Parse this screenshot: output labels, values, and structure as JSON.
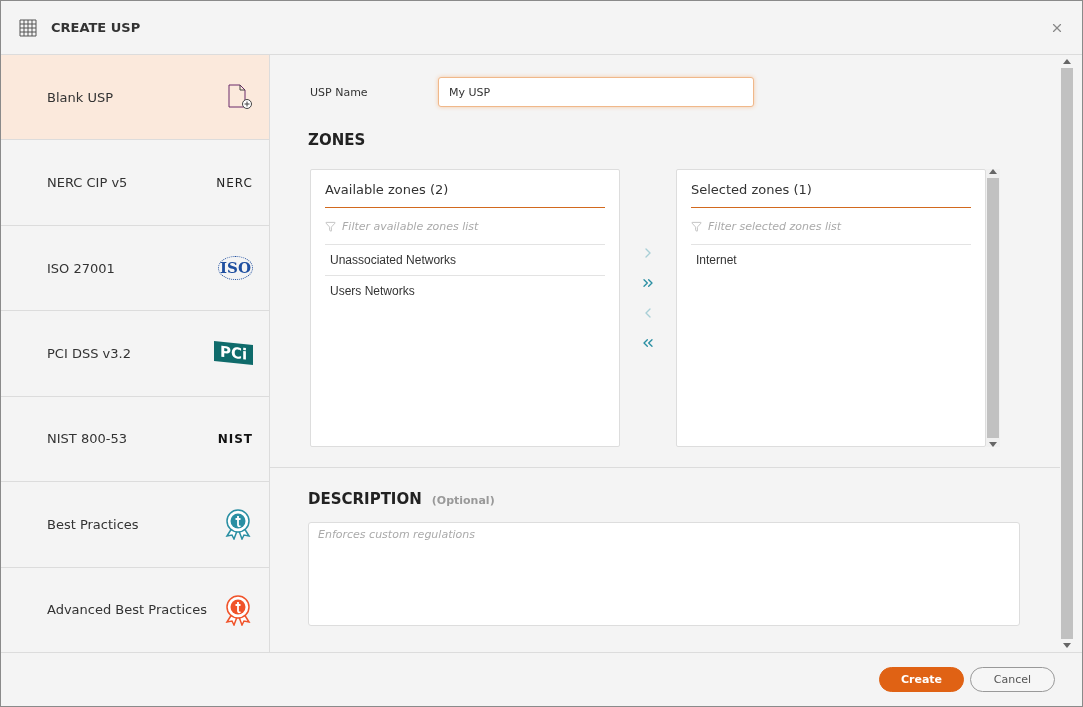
{
  "window": {
    "title": "CREATE USP"
  },
  "templates": [
    {
      "label": "Blank USP",
      "kind": "blank",
      "selected": true
    },
    {
      "label": "NERC CIP v5",
      "kind": "wordmark",
      "logo": "NERC",
      "color": "#222222",
      "selected": false
    },
    {
      "label": "ISO 27001",
      "kind": "iso",
      "logo": "ISO",
      "color": "#1f4fa0",
      "selected": false
    },
    {
      "label": "PCI DSS v3.2",
      "kind": "pci",
      "logo": "PCi",
      "color": "#0f6b6b",
      "selected": false
    },
    {
      "label": "NIST 800-53",
      "kind": "wordmark",
      "logo": "NIST",
      "color": "#111111",
      "selected": false
    },
    {
      "label": "Best Practices",
      "kind": "badge",
      "color": "#2a8fa3",
      "selected": false
    },
    {
      "label": "Advanced Best Practices",
      "kind": "badge",
      "color": "#f0532a",
      "selected": false
    }
  ],
  "usp_name": {
    "label": "USP Name",
    "value": "My USP"
  },
  "zones": {
    "title": "ZONES",
    "available": {
      "title": "Available zones (2)",
      "placeholder": "Filter available zones list",
      "items": [
        "Unassociated Networks",
        "Users Networks"
      ]
    },
    "transfer": [
      {
        "kind": "one-right",
        "disabled": true
      },
      {
        "kind": "all-right",
        "disabled": false
      },
      {
        "kind": "one-left",
        "disabled": true
      },
      {
        "kind": "all-left",
        "disabled": false
      }
    ],
    "selected": {
      "title": "Selected zones (1)",
      "placeholder": "Filter selected zones list",
      "items": [
        "Internet"
      ]
    }
  },
  "description": {
    "title": "DESCRIPTION",
    "note": "(Optional)",
    "placeholder": "Enforces custom regulations"
  },
  "buttons": [
    {
      "label": "Create",
      "kind": "primary"
    },
    {
      "label": "Cancel",
      "kind": "secondary"
    }
  ]
}
